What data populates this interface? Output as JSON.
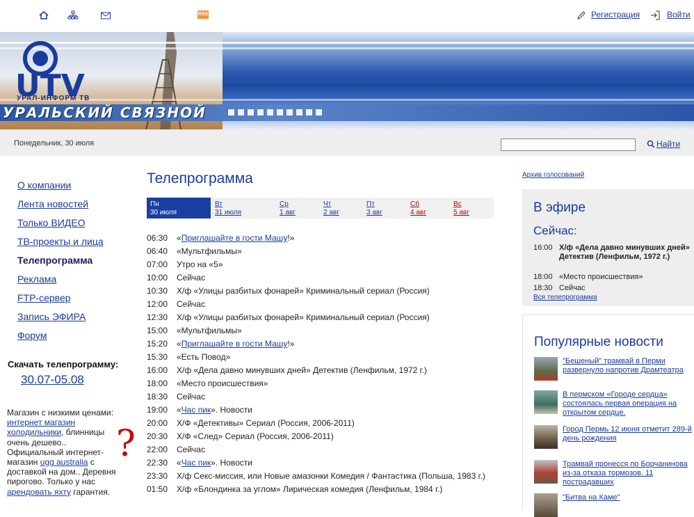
{
  "topbar": {
    "rss": "RSS",
    "register": "Регистрация",
    "login": "Войти"
  },
  "banner": {
    "logo_text": "UTV",
    "logo_sub": "УРАЛ-ИНФОРМ ТВ",
    "title": "УРАЛЬСКИЙ СВЯЗНОЙ"
  },
  "subbar": {
    "date": "Понедельник, 30 июля",
    "search_value": "",
    "find_label": "Найти"
  },
  "nav": {
    "items": [
      {
        "label": "О компании"
      },
      {
        "label": "Лента новостей"
      },
      {
        "label": "Только ВИДЕО"
      },
      {
        "label": "ТВ-проекты и лица"
      },
      {
        "label": "Телепрограмма"
      },
      {
        "label": "Реклама"
      },
      {
        "label": "FTP-сервер"
      },
      {
        "label": "Запись ЭФИРА"
      },
      {
        "label": "Форум"
      }
    ],
    "download_label": "Скачать телепрограмму:",
    "download_link": "30.07-05.08"
  },
  "ad": {
    "t1": "Магазин с низкими ценами: ",
    "l1": "интернет магазин холодильники",
    "t2": ", блинницы очень дешево.. Официальный интернет-магазин ",
    "l2": "ugg australia",
    "t3": " с доставкой на дом.. Деревня пирогово. Только у нас ",
    "l3": "арендовать яхту",
    "t4": " гарантия.",
    "qmark": "?"
  },
  "main": {
    "title": "Телепрограмма",
    "days": [
      {
        "d": "Пн",
        "date": "30 июля"
      },
      {
        "d": "Вт",
        "date": "31 июля"
      },
      {
        "d": "Ср",
        "date": "1 авг"
      },
      {
        "d": "Чт",
        "date": "2 авг"
      },
      {
        "d": "Пт",
        "date": "3 авг"
      },
      {
        "d": "Сб",
        "date": "4 авг"
      },
      {
        "d": "Вс",
        "date": "5 авг"
      }
    ],
    "schedule": [
      {
        "time": "06:30",
        "pre": "«",
        "link": "Приглашайте в гости Машу",
        "post": "!»"
      },
      {
        "time": "06:40",
        "text": "«Мультфильмы»"
      },
      {
        "time": "07:00",
        "text": "Утро на «5»"
      },
      {
        "time": "10:00",
        "text": "Сейчас"
      },
      {
        "time": "10:30",
        "text": "Х/ф «Улицы разбитых фонарей» Криминальный сериал (Россия)"
      },
      {
        "time": "12:00",
        "text": "Сейчас"
      },
      {
        "time": "12:30",
        "text": "Х/ф «Улицы разбитых фонарей» Криминальный сериал (Россия)"
      },
      {
        "time": "15:00",
        "text": "«Мультфильмы»"
      },
      {
        "time": "15:20",
        "pre": "«",
        "link": "Приглашайте в гости Машу",
        "post": "!»"
      },
      {
        "time": "15:30",
        "text": "«Есть Повод»"
      },
      {
        "time": "16:00",
        "text": "Х/ф «Дела давно минувших дней» Детектив (Ленфильм, 1972 г.)"
      },
      {
        "time": "18:00",
        "text": "«Место происшествия»"
      },
      {
        "time": "18:30",
        "text": "Сейчас"
      },
      {
        "time": "19:00",
        "pre": "«",
        "link": "Час пик",
        "post": "». Новости"
      },
      {
        "time": "20:00",
        "text": "Х/Ф «Детективы» Сериал (Россия, 2006-2011)"
      },
      {
        "time": "20:30",
        "text": "Х/Ф «След» Сериал (Россия, 2006-2011)"
      },
      {
        "time": "22:00",
        "text": "Сейчас"
      },
      {
        "time": "22:30",
        "pre": "«",
        "link": "Час пик",
        "post": "». Новости"
      },
      {
        "time": "23:30",
        "text": "Х/ф Секс-миссия, или Новые амазонки Комедия / Фантастика (Польша, 1983 г.)"
      },
      {
        "time": "01:50",
        "text": "Х/ф «Блондинка за углом» Лирическая комедия (Ленфильм, 1984 г.)"
      }
    ]
  },
  "right": {
    "archive": "Архив голосований",
    "onair_title": "В эфире",
    "now_title": "Сейчас:",
    "onair": [
      {
        "time": "16:00",
        "text": "Х/ф «Дела давно минувших дней» Детектив (Ленфильм, 1972 г.)"
      },
      {
        "time": "18:00",
        "text": "«Место происшествия»"
      },
      {
        "time": "18:30",
        "text": "Сейчас"
      }
    ],
    "all_program": "Вся телепрограмма",
    "popular_title": "Популярные новости",
    "news": [
      {
        "text": "\"Бешеный\" трамвай в Перми развернуло напротив Драмтеатра"
      },
      {
        "text": "В пермском «Городе сердца» состоялась первая операция на открытом сердце."
      },
      {
        "text": "Город Пермь 12 июня отметит 289-й день рождения"
      },
      {
        "text": "Трамвай пронесся по Борчанинова из-за отказа тормозов. 11 пострадавших"
      },
      {
        "text": "\"Битва на Каме\""
      }
    ]
  }
}
